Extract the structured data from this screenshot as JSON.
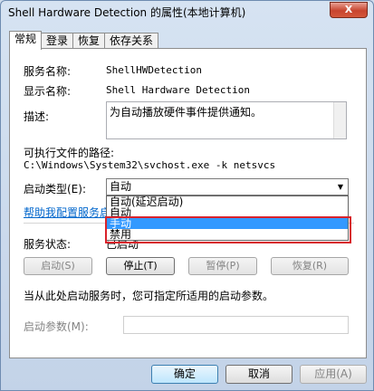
{
  "window": {
    "title": "Shell Hardware Detection 的属性(本地计算机)",
    "close_label": "X"
  },
  "tabs": [
    {
      "label": "常规"
    },
    {
      "label": "登录"
    },
    {
      "label": "恢复"
    },
    {
      "label": "依存关系"
    }
  ],
  "general": {
    "service_name_label": "服务名称:",
    "service_name": "ShellHWDetection",
    "display_name_label": "显示名称:",
    "display_name": "Shell Hardware Detection",
    "description_label": "描述:",
    "description": "为自动播放硬件事件提供通知。",
    "path_label": "可执行文件的路径:",
    "path": "C:\\Windows\\System32\\svchost.exe -k netsvcs",
    "startup_type_label": "启动类型(E):",
    "startup_type_value": "自动",
    "startup_options": [
      "自动(延迟启动)",
      "自动",
      "手动",
      "禁用"
    ],
    "help_link": "帮助我配置服务启",
    "status_label": "服务状态:",
    "status_value": "已启动",
    "buttons": {
      "start": "启动(S)",
      "stop": "停止(T)",
      "pause": "暂停(P)",
      "resume": "恢复(R)"
    },
    "hint": "当从此处启动服务时，您可指定所适用的启动参数。",
    "params_label": "启动参数(M):",
    "params_value": ""
  },
  "footer": {
    "ok": "确定",
    "cancel": "取消",
    "apply": "应用(A)"
  },
  "colors": {
    "highlight": "#3399ff",
    "annotation": "#d9232b",
    "link": "#0066cc"
  }
}
